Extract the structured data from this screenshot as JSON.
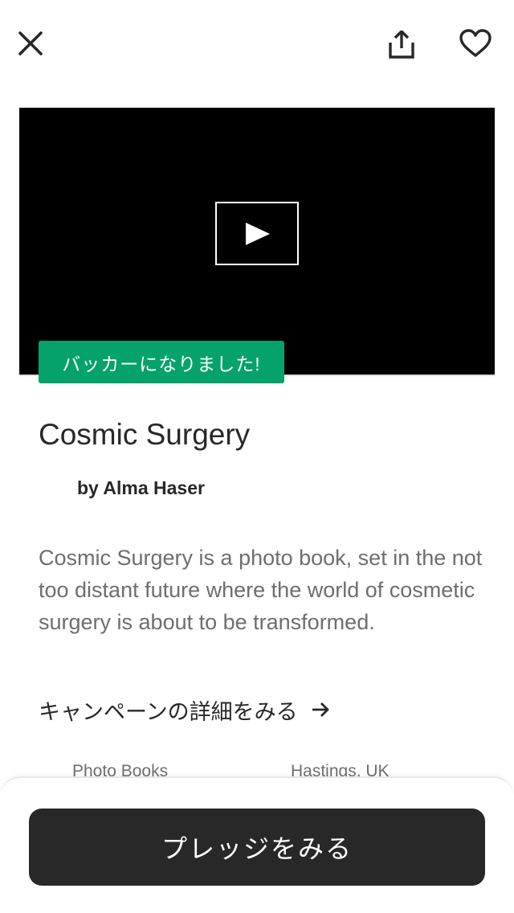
{
  "header": {
    "close_icon": "close-icon",
    "share_icon": "share-icon",
    "favorite_icon": "heart-icon"
  },
  "video": {
    "play_icon": "play-icon"
  },
  "badge": {
    "label": "バッカーになりました!",
    "color": "#05a36b"
  },
  "project": {
    "title": "Cosmic Surgery",
    "creator": "by Alma Haser",
    "description": "Cosmic Surgery is a photo book, set in the not too distant future where the world of cosmetic surgery is about to be transformed.",
    "details_link": "キャンペーンの詳細をみる",
    "category": "Photo Books",
    "location": "Hastings, UK"
  },
  "footer": {
    "pledge_button": "プレッジをみる"
  }
}
